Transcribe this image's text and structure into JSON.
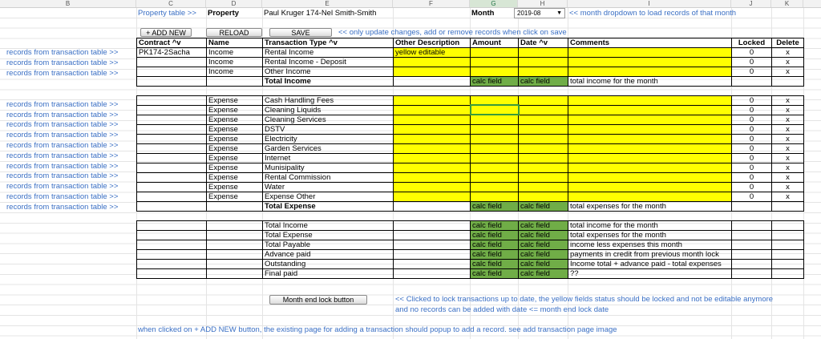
{
  "columns": [
    "B",
    "C",
    "D",
    "E",
    "F",
    "G",
    "H",
    "I",
    "J",
    "K"
  ],
  "top": {
    "property_link": "Property table >>",
    "property_label": "Property",
    "property_value": "Paul Kruger 174-Nel Smith-Smith",
    "month_label": "Month",
    "month_value": "2019-08",
    "month_note": "<< month dropdown to load records of that month"
  },
  "buttons": {
    "add_new": "+ ADD NEW",
    "reload": "RELOAD",
    "save": "SAVE",
    "save_note": "<< only update  changes, add or remove records when click on save",
    "lock": "Month end lock button"
  },
  "table_headers": [
    "Contract ^v",
    "Name",
    "Transaction Type ^v",
    "Other Description",
    "Amount",
    "Date ^v",
    "Comments",
    "Locked",
    "Delete"
  ],
  "side_link": "records from transaction table >>",
  "income_rows": [
    {
      "contract": "PK174-2Sacha",
      "name": "Income",
      "type": "Rental Income",
      "other": "yellow editable",
      "locked": "0",
      "delete": "x"
    },
    {
      "contract": "",
      "name": "Income",
      "type": "Rental Income - Deposit",
      "other": "",
      "locked": "0",
      "delete": "x"
    },
    {
      "contract": "",
      "name": "Income",
      "type": "Other Income",
      "other": "",
      "locked": "0",
      "delete": "x"
    }
  ],
  "total_income": {
    "label": "Total Income",
    "amount": "calc field",
    "date": "calc field",
    "comment": "total income for the month"
  },
  "expense_rows": [
    {
      "name": "Expense",
      "type": "Cash Handling Fees",
      "locked": "0",
      "delete": "x"
    },
    {
      "name": "Expense",
      "type": "Cleaning Liquids",
      "locked": "0",
      "delete": "x"
    },
    {
      "name": "Expense",
      "type": "Cleaning Services",
      "locked": "0",
      "delete": "x"
    },
    {
      "name": "Expense",
      "type": "DSTV",
      "locked": "0",
      "delete": "x"
    },
    {
      "name": "Expense",
      "type": "Electricity",
      "locked": "0",
      "delete": "x"
    },
    {
      "name": "Expense",
      "type": "Garden Services",
      "locked": "0",
      "delete": "x"
    },
    {
      "name": "Expense",
      "type": "Internet",
      "locked": "0",
      "delete": "x"
    },
    {
      "name": "Expense",
      "type": "Munisipality",
      "locked": "0",
      "delete": "x"
    },
    {
      "name": "Expense",
      "type": "Rental Commission",
      "locked": "0",
      "delete": "x"
    },
    {
      "name": "Expense",
      "type": "Water",
      "locked": "0",
      "delete": "x"
    },
    {
      "name": "Expense",
      "type": "Expense Other",
      "locked": "0",
      "delete": "x"
    }
  ],
  "total_expense": {
    "label": "Total Expense",
    "amount": "calc field",
    "date": "calc field",
    "comment": "total expenses for the month"
  },
  "summary_rows": [
    {
      "label": "Total Income",
      "amount": "calc field",
      "date": "calc field",
      "comment": "total income for the month"
    },
    {
      "label": "Total Expense",
      "amount": "calc field",
      "date": "calc field",
      "comment": "total expenses for the month"
    },
    {
      "label": "Total Payable",
      "amount": "calc field",
      "date": "calc field",
      "comment": "income less expenses this month"
    },
    {
      "label": "Advance paid",
      "amount": "calc field",
      "date": "calc field",
      "comment": "payments in credit from previous month lock"
    },
    {
      "label": "Outstanding",
      "amount": "calc field",
      "date": "calc field",
      "comment": "Income total + advance paid - total expenses"
    },
    {
      "label": "Final paid",
      "amount": "calc field",
      "date": "calc field",
      "comment": "??"
    }
  ],
  "lock_note_1": "<< Clicked to lock transactions up to date, the yellow fields status should be locked and not be editable anymore",
  "lock_note_2": "and no records can be added with date <= month end lock date",
  "footer_note": "when clicked on + ADD NEW button, the existing page for adding a transaction should popup to add a record.  see add transaction page image",
  "colors": {
    "editable": "#ffff00",
    "calc": "#70ad47",
    "link": "#3a6fc4"
  }
}
